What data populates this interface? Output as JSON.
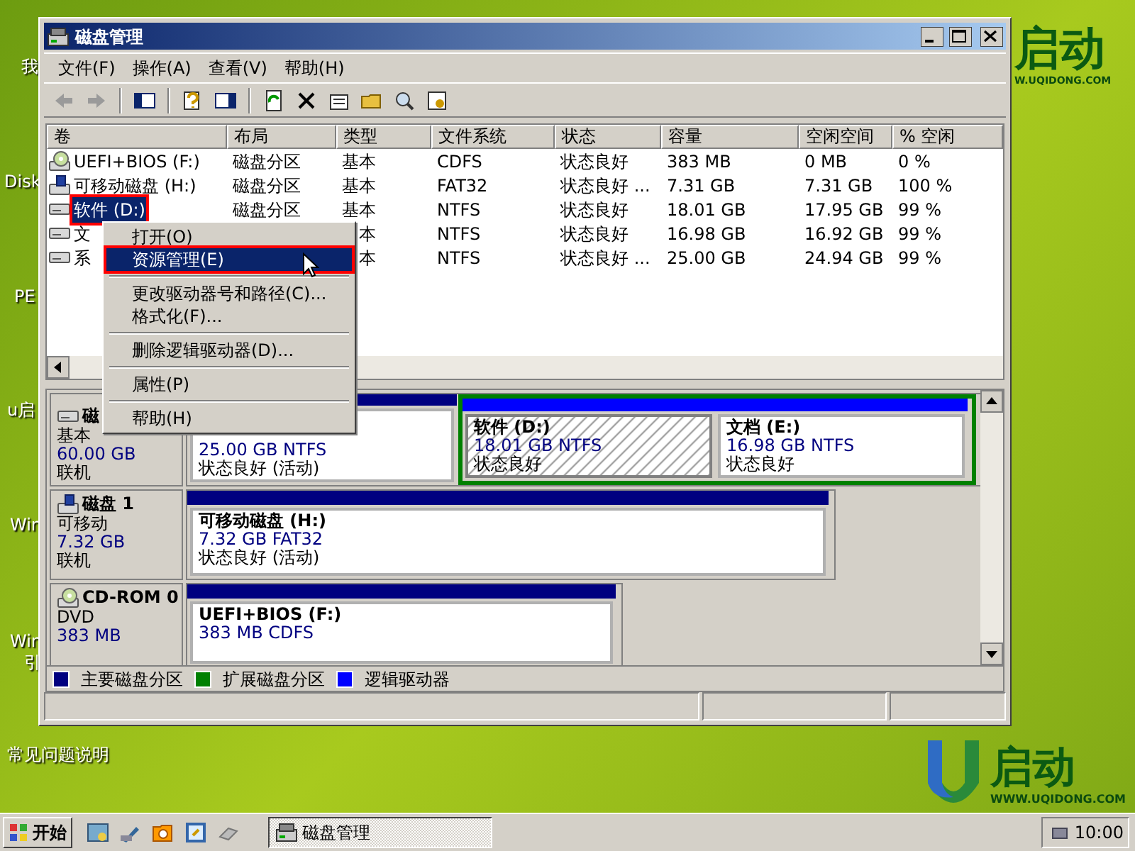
{
  "desktop_icons": [
    {
      "label": "我"
    },
    {
      "label": "Disk"
    },
    {
      "label": "PE"
    },
    {
      "label": "u启"
    },
    {
      "label": "Win"
    },
    {
      "label": "Win"
    },
    {
      "label": "引"
    },
    {
      "label": "常见问题说明"
    }
  ],
  "window": {
    "title": "磁盘管理"
  },
  "menu_bar": [
    "文件(F)",
    "操作(A)",
    "查看(V)",
    "帮助(H)"
  ],
  "table": {
    "columns": [
      "卷",
      "布局",
      "类型",
      "文件系统",
      "状态",
      "容量",
      "空闲空间",
      "% 空闲"
    ],
    "rows": [
      {
        "kind": "cd",
        "selected": false,
        "annotated": false,
        "cells": [
          "UEFI+BIOS (F:)",
          "磁盘分区",
          "基本",
          "CDFS",
          "状态良好",
          "383 MB",
          "0 MB",
          "0 %"
        ]
      },
      {
        "kind": "removable",
        "selected": false,
        "annotated": false,
        "cells": [
          "可移动磁盘 (H:)",
          "磁盘分区",
          "基本",
          "FAT32",
          "状态良好 ...",
          "7.31 GB",
          "7.31 GB",
          "100 %"
        ]
      },
      {
        "kind": "disk",
        "selected": true,
        "annotated": true,
        "cells": [
          "软件 (D:)",
          "磁盘分区",
          "基本",
          "NTFS",
          "状态良好",
          "18.01 GB",
          "17.95 GB",
          "99 %"
        ]
      },
      {
        "kind": "disk",
        "selected": false,
        "annotated": false,
        "cells": [
          "文",
          null,
          "本",
          "NTFS",
          "状态良好",
          "16.98 GB",
          "16.92 GB",
          "99 %"
        ]
      },
      {
        "kind": "disk",
        "selected": false,
        "annotated": false,
        "cells": [
          "系",
          null,
          "本",
          "NTFS",
          "状态良好 ...",
          "25.00 GB",
          "24.94 GB",
          "99 %"
        ]
      }
    ]
  },
  "context_menu": {
    "items": [
      {
        "kind": "item",
        "label": "打开(O)",
        "selected": false,
        "annotated": false
      },
      {
        "kind": "item",
        "label": "资源管理(E)",
        "selected": true,
        "annotated": true
      },
      {
        "kind": "separator"
      },
      {
        "kind": "item",
        "label": "更改驱动器号和路径(C)...",
        "selected": false,
        "annotated": false
      },
      {
        "kind": "item",
        "label": "格式化(F)...",
        "selected": false,
        "annotated": false
      },
      {
        "kind": "separator"
      },
      {
        "kind": "item",
        "label": "删除逻辑驱动器(D)...",
        "selected": false,
        "annotated": false
      },
      {
        "kind": "separator"
      },
      {
        "kind": "item",
        "label": "属性(P)",
        "selected": false,
        "annotated": false
      },
      {
        "kind": "separator"
      },
      {
        "kind": "item",
        "label": "帮助(H)",
        "selected": false,
        "annotated": false
      }
    ]
  },
  "disks": [
    {
      "kind": "disk",
      "name": "磁",
      "type": "基本",
      "size": "60.00 GB",
      "status": "联机",
      "partitions": [
        {
          "kind": "primary",
          "detail": "25.00 GB NTFS",
          "status": "状态良好 (活动)"
        },
        {
          "kind": "extended",
          "children": [
            {
              "kind": "logical",
              "name": "软件 (D:)",
              "detail": "18.01 GB NTFS",
              "status": "状态良好",
              "selected": true
            },
            {
              "kind": "logical",
              "name": "文档 (E:)",
              "detail": "16.98 GB NTFS",
              "status": "状态良好",
              "selected": false
            }
          ]
        }
      ]
    },
    {
      "kind": "removable",
      "name": "磁盘 1",
      "type": "可移动",
      "size": "7.32 GB",
      "status": "联机",
      "partitions": [
        {
          "kind": "primary",
          "name": "可移动磁盘 (H:)",
          "detail": "7.32 GB FAT32",
          "status": "状态良好 (活动)"
        }
      ]
    },
    {
      "kind": "cd",
      "name": "CD-ROM 0",
      "type": "DVD",
      "size": "383 MB",
      "partitions": [
        {
          "kind": "primary",
          "name": "UEFI+BIOS (F:)",
          "detail": "383 MB CDFS"
        }
      ]
    }
  ],
  "legend": [
    {
      "label": "主要磁盘分区",
      "color": "#000080"
    },
    {
      "label": "扩展磁盘分区",
      "color": "#008000"
    },
    {
      "label": "逻辑驱动器",
      "color": "#0000ff"
    }
  ],
  "taskbar": {
    "start": "开始",
    "tasks": [
      {
        "label": "磁盘管理",
        "selected": true
      }
    ],
    "clock": "10:00"
  },
  "logos": {
    "top": {
      "mark": "启动",
      "url": "W.UQIDONG.COM"
    },
    "bottom": {
      "mark": "启动",
      "url": "WWW.UQIDONG.COM"
    }
  }
}
